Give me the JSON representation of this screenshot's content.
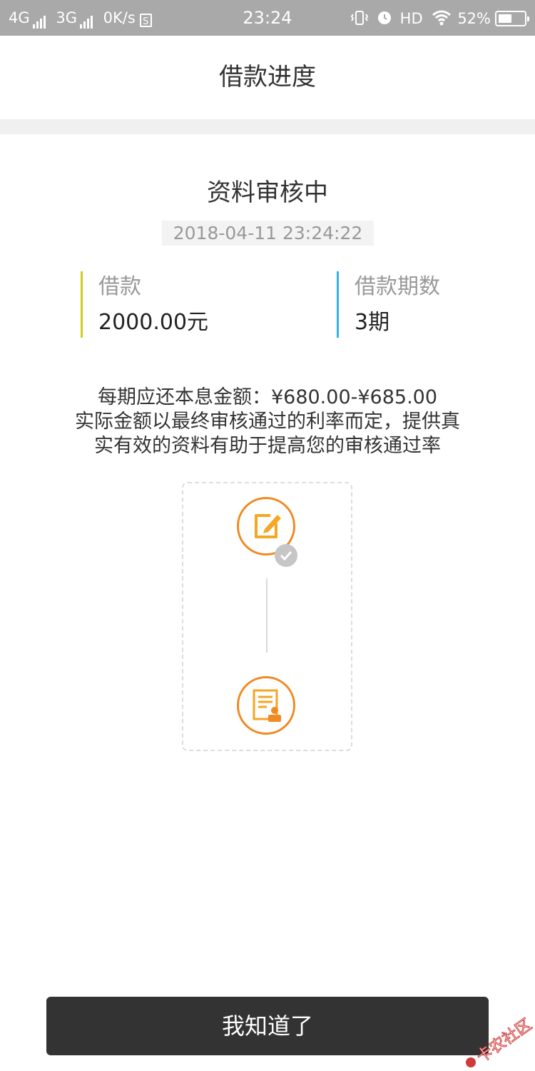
{
  "status_bar": {
    "net1": "4G",
    "net2": "3G",
    "speed": "0K/s",
    "sim_glyph": "S",
    "time": "23:24",
    "hd": "HD",
    "battery_text": "52%",
    "battery_level": 0.52,
    "icons": [
      "signal-icon",
      "vibrate-icon",
      "alarm-icon",
      "wifi-icon",
      "battery-icon"
    ]
  },
  "header": {
    "title": "借款进度"
  },
  "status": {
    "title": "资料审核中",
    "timestamp": "2018-04-11 23:24:22"
  },
  "loan": {
    "amount_label": "借款",
    "amount_value": "2000.00元",
    "term_label": "借款期数",
    "term_value": "3期"
  },
  "notice": {
    "line1": "每期应还本息金额：¥680.00-¥685.00",
    "line2": "实际金额以最终审核通过的利率而定，提供真",
    "line3": "实有效的资料有助于提高您的审核通过率"
  },
  "steps": [
    {
      "icon": "edit-form-icon",
      "completed": true
    },
    {
      "icon": "review-document-icon",
      "completed": false
    }
  ],
  "button": {
    "label": "我知道了"
  },
  "colors": {
    "accent_orange": "#f08a22",
    "amount_bar": "#cfcf1f",
    "term_bar": "#2fb2e8",
    "button_bg": "#333333",
    "status_bar_bg": "#a9a9a9"
  },
  "watermark": {
    "text": "卡农社区"
  }
}
